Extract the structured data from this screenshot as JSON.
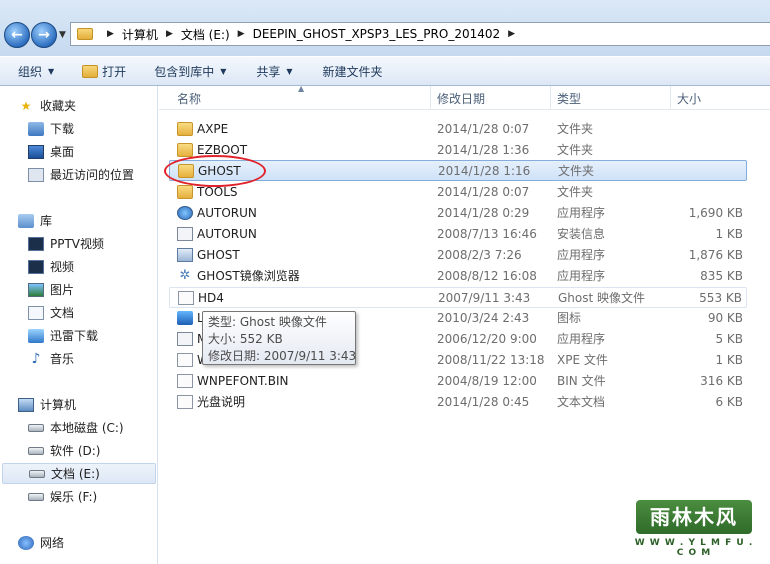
{
  "address": {
    "crumbs": [
      "计算机",
      "文档 (E:)",
      "DEEPIN_GHOST_XPSP3_LES_PRO_201402"
    ]
  },
  "toolbar": {
    "organize": "组织",
    "open": "打开",
    "include_library": "包含到库中",
    "share": "共享",
    "new_folder": "新建文件夹"
  },
  "nav": {
    "favorites": "收藏夹",
    "downloads": "下载",
    "desktop": "桌面",
    "recent": "最近访问的位置",
    "library": "库",
    "pptv": "PPTV视频",
    "videos": "视频",
    "pictures": "图片",
    "documents": "文档",
    "xunlei": "迅雷下载",
    "music": "音乐",
    "computer": "计算机",
    "drive_c": "本地磁盘 (C:)",
    "drive_d": "软件 (D:)",
    "drive_e": "文档 (E:)",
    "drive_f": "娱乐 (F:)",
    "network": "网络"
  },
  "columns": {
    "name": "名称",
    "date": "修改日期",
    "type": "类型",
    "size": "大小"
  },
  "files": [
    {
      "name": "AXPE",
      "date": "2014/1/28 0:07",
      "type": "文件夹",
      "size": "",
      "icon": "folder-icon"
    },
    {
      "name": "EZBOOT",
      "date": "2014/1/28 1:36",
      "type": "文件夹",
      "size": "",
      "icon": "folder-icon"
    },
    {
      "name": "GHOST",
      "date": "2014/1/28 1:16",
      "type": "文件夹",
      "size": "",
      "icon": "folder-icon"
    },
    {
      "name": "TOOLS",
      "date": "2014/1/28 0:07",
      "type": "文件夹",
      "size": "",
      "icon": "folder-icon"
    },
    {
      "name": "AUTORUN",
      "date": "2014/1/28 0:29",
      "type": "应用程序",
      "size": "1,690 KB",
      "icon": "exe-icon"
    },
    {
      "name": "AUTORUN",
      "date": "2008/7/13 16:46",
      "type": "安装信息",
      "size": "1 KB",
      "icon": "inf-icon"
    },
    {
      "name": "GHOST",
      "date": "2008/2/3 7:26",
      "type": "应用程序",
      "size": "1,876 KB",
      "icon": "ghost-app-icon"
    },
    {
      "name": "GHOST镜像浏览器",
      "date": "2008/8/12 16:08",
      "type": "应用程序",
      "size": "835 KB",
      "icon": "ghost-viewer-icon"
    },
    {
      "name": "HD4",
      "date": "2007/9/11 3:43",
      "type": "Ghost 映像文件",
      "size": "553 KB",
      "icon": "ghost-image-icon"
    },
    {
      "name": "L",
      "date": "2010/3/24 2:43",
      "type": "图标",
      "size": "90 KB",
      "icon": "ico-file-icon"
    },
    {
      "name": "M",
      "date": "2006/12/20 9:00",
      "type": "应用程序",
      "size": "5 KB",
      "icon": "exe-icon"
    },
    {
      "name": "W",
      "date": "2008/11/22 13:18",
      "type": "XPE 文件",
      "size": "1 KB",
      "icon": "file-icon"
    },
    {
      "name": "WNPEFONT.BIN",
      "date": "2004/8/19 12:00",
      "type": "BIN 文件",
      "size": "316 KB",
      "icon": "file-icon"
    },
    {
      "name": "光盘说明",
      "date": "2014/1/28 0:45",
      "type": "文本文档",
      "size": "6 KB",
      "icon": "text-icon"
    }
  ],
  "tooltip": {
    "type_line": "类型: Ghost 映像文件",
    "size_line": "大小: 552 KB",
    "date_line": "修改日期: 2007/9/11 3:43"
  },
  "watermark": {
    "logo_text": "雨林木风",
    "url": "W W W . Y L M F U . C O M"
  }
}
